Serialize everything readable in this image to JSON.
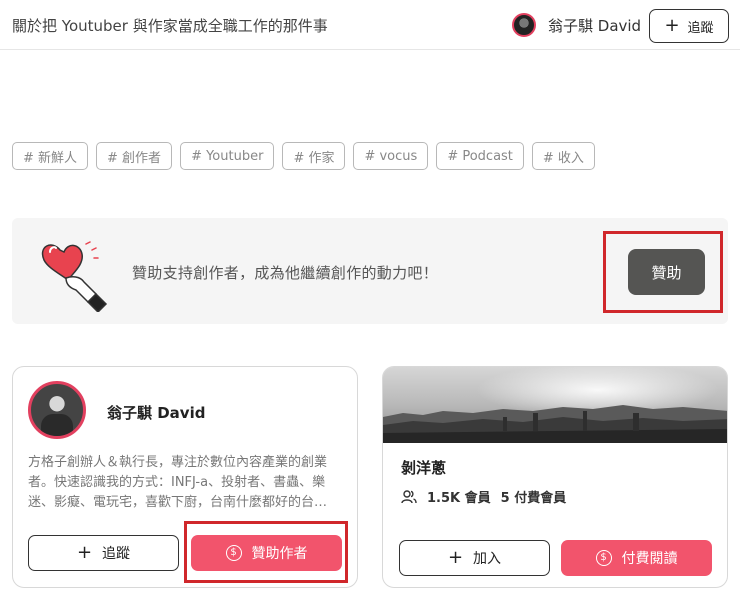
{
  "header": {
    "title": "關於把 Youtuber 與作家當成全職工作的那件事",
    "author_name": "翁子騏 David",
    "follow_label": "追蹤"
  },
  "tags": [
    "# 新鮮人",
    "# 創作者",
    "# Youtuber",
    "# 作家",
    "# vocus",
    "# Podcast",
    "# 收入"
  ],
  "sponsor_banner": {
    "text": "贊助支持創作者，成為他繼續創作的動力吧！",
    "button_label": "贊助"
  },
  "author_card": {
    "name": "翁子騏 David",
    "bio": "方格子創辦人＆執行長，專注於數位內容產業的創業者。快速認識我的方式：INFJ-a、投射者、書蟲、樂迷、影癡、電玩宅，喜歡下廚，台南什麼都好的台…",
    "follow_label": "追蹤",
    "sponsor_label": "贊助作者"
  },
  "club_card": {
    "name": "剝洋蔥",
    "members": "1.5K 會員",
    "paid_members": "5 付費會員",
    "join_label": "加入",
    "pay_label": "付費閱讀"
  },
  "colors": {
    "accent_pink": "#f2546c",
    "avatar_ring": "#e2405f",
    "dark_button": "#555553",
    "highlight_red": "#d0272b"
  },
  "icons": [
    "plus-icon",
    "heart-hand-icon",
    "dollar-circle-icon",
    "members-icon"
  ]
}
